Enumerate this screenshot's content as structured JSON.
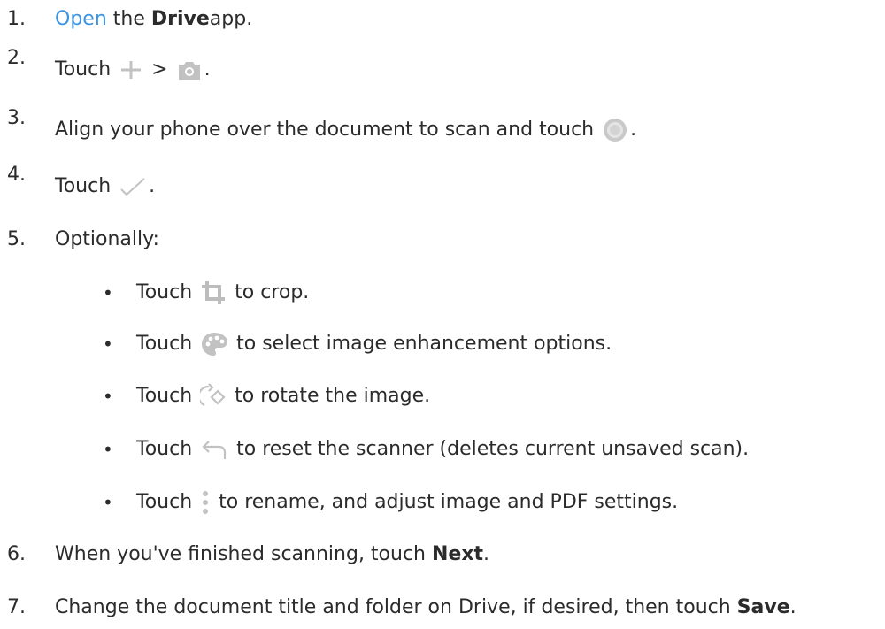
{
  "steps": [
    {
      "num": "1.",
      "link": "Open",
      "t1": " the ",
      "bold": "Drive",
      "t2": " app."
    },
    {
      "num": "2.",
      "t1": "Touch ",
      "sep": " > ",
      "t2": "."
    },
    {
      "num": "3.",
      "t1": "Align your phone over the document to scan and touch ",
      "t2": "."
    },
    {
      "num": "4.",
      "t1": "Touch ",
      "t2": "."
    },
    {
      "num": "5.",
      "t1": "Optionally:"
    },
    {
      "num": "6.",
      "t1": "When you've finished scanning, touch ",
      "bold": "Next",
      "t2": "."
    },
    {
      "num": "7.",
      "t1": "Change the document title and folder on Drive, if desired, then touch ",
      "bold": "Save",
      "t2": "."
    }
  ],
  "bullet_char": "•",
  "substeps": [
    {
      "t1": "Touch ",
      "t2": " to crop.",
      "icon": "crop-icon"
    },
    {
      "t1": "Touch ",
      "t2": " to select image enhancement options.",
      "icon": "palette-icon"
    },
    {
      "t1": "Touch ",
      "t2": " to rotate the image.",
      "icon": "rotate-icon"
    },
    {
      "t1": "Touch ",
      "t2": " to reset the scanner (deletes current unsaved scan).",
      "icon": "undo-icon"
    },
    {
      "t1": "Touch ",
      "t2": " to rename, and adjust image and PDF settings.",
      "icon": "more-vert-icon"
    }
  ],
  "colors": {
    "text": "#2b2b2b",
    "link": "#3b94e3",
    "icon": "#c2c2c2"
  }
}
